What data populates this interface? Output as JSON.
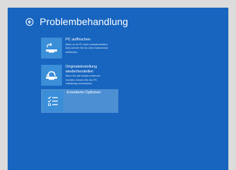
{
  "header": {
    "title": "Problembehandlung"
  },
  "options": [
    {
      "title": "PC auffrischen",
      "description": [
        "Wenn es Ihr PC nicht zufriedenstellend",
        "läuft, können Sie ihn ohne Datenverlust",
        "auffrischen."
      ],
      "icon": "refresh-pc-icon"
    },
    {
      "title_lines": [
        "Originaleinstellung",
        "wiederherstellen"
      ],
      "description": [
        "Wenn Sie alle Dateien entfernen",
        "möchten, können Sie den PC",
        "vollständig zurücksetzen."
      ],
      "icon": "reset-pc-icon"
    },
    {
      "title": "Erweiterte Optionen",
      "icon": "advanced-options-icon"
    }
  ],
  "colors": {
    "background": "#1765bf",
    "tile": "#3b8ed8",
    "selected": "#4c8fd3"
  }
}
